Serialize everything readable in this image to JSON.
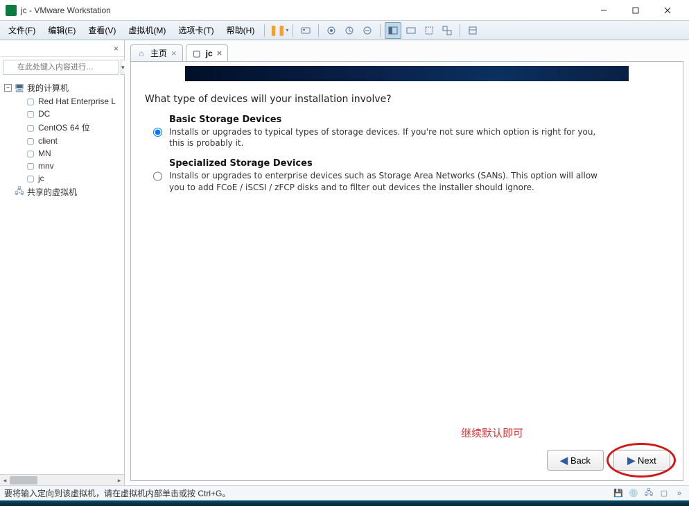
{
  "window": {
    "title": "jc - VMware Workstation"
  },
  "menu": {
    "file": "文件(F)",
    "edit": "编辑(E)",
    "view": "查看(V)",
    "vm": "虚拟机(M)",
    "tabs": "选项卡(T)",
    "help": "帮助(H)"
  },
  "sidebar": {
    "search_placeholder": "在此处键入内容进行…",
    "root": "我的计算机",
    "items": [
      "Red Hat Enterprise L",
      "DC",
      "CentOS 64 位",
      "client",
      "MN",
      "mnv",
      "jc"
    ],
    "shared": "共享的虚拟机"
  },
  "tabs": {
    "home": "主页",
    "jc": "jc"
  },
  "installer": {
    "question": "What type of devices will your installation involve?",
    "opt1_title": "Basic Storage Devices",
    "opt1_desc": "Installs or upgrades to typical types of storage devices.  If you're not sure which option is right for you, this is probably it.",
    "opt2_title": "Specialized Storage Devices",
    "opt2_desc": "Installs or upgrades to enterprise devices such as Storage Area Networks (SANs). This option will allow you to add FCoE / iSCSI / zFCP disks and to filter out devices the installer should ignore.",
    "back": "Back",
    "next": "Next"
  },
  "annotation": "继续默认即可",
  "hint": "要将输入定向到该虚拟机，请在虚拟机内部单击或按 Ctrl+G。"
}
